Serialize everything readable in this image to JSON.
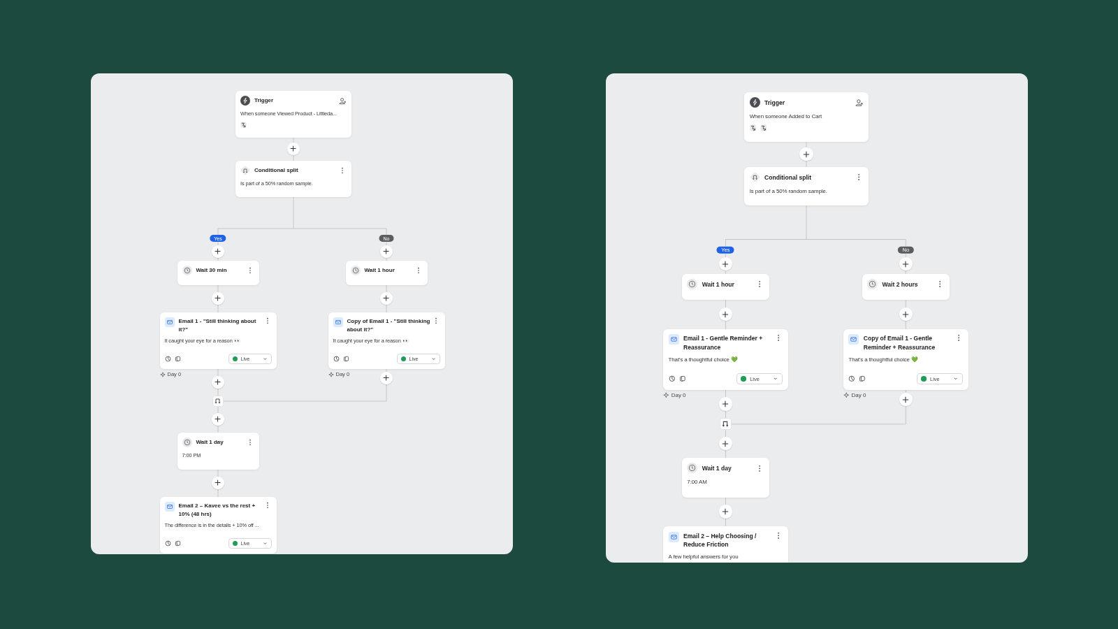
{
  "flows": [
    {
      "trigger": {
        "title": "Trigger",
        "description": "When someone Viewed Product - Littleda...",
        "filters": [
          {
            "kind": "filter"
          }
        ]
      },
      "split": {
        "title": "Conditional split",
        "description": "Is part of a 50% random sample."
      },
      "branches": [
        {
          "label": "Yes",
          "kind": "yes",
          "steps": [
            {
              "kind": "wait",
              "title": "Wait 30 min"
            },
            {
              "kind": "email",
              "title": "Email 1 - \"Still thinking about it?\"",
              "preview": "It caught your eye for a reason 👀",
              "status": "Live",
              "live": true,
              "day": "Day 0"
            }
          ]
        },
        {
          "label": "No",
          "kind": "no",
          "steps": [
            {
              "kind": "wait",
              "title": "Wait 1 hour"
            },
            {
              "kind": "email",
              "title": "Copy of Email 1 - \"Still thinking about it?\"",
              "preview": "It caught your eye for a reason 👀",
              "status": "Live",
              "live": true,
              "day": "Day 0"
            }
          ]
        }
      ],
      "after_merge": [
        {
          "kind": "wait",
          "title": "Wait 1 day",
          "detail": "7:00 PM"
        },
        {
          "kind": "email",
          "title": "Email 2 – Kavee vs the rest + 10% (48 hrs)",
          "preview": "The difference is in the details + 10% off ...",
          "status": "Live",
          "live": true
        }
      ]
    },
    {
      "trigger": {
        "title": "Trigger",
        "description": "When someone Added to Cart",
        "filters": [
          {
            "kind": "filter"
          },
          {
            "kind": "filter"
          }
        ]
      },
      "split": {
        "title": "Conditional split",
        "description": "Is part of a 50% random sample."
      },
      "branches": [
        {
          "label": "Yes",
          "kind": "yes",
          "steps": [
            {
              "kind": "wait",
              "title": "Wait 1 hour"
            },
            {
              "kind": "email",
              "title": "Email 1 - Gentle Reminder + Reassurance",
              "preview": "That's a thoughtful choice 💚",
              "status": "Live",
              "live": true,
              "day": "Day 0"
            }
          ]
        },
        {
          "label": "No",
          "kind": "no",
          "steps": [
            {
              "kind": "wait",
              "title": "Wait 2 hours"
            },
            {
              "kind": "email",
              "title": "Copy of Email 1 - Gentle Reminder + Reassurance",
              "preview": "That's a thoughtful choice 💚",
              "status": "Live",
              "live": true,
              "day": "Day 0"
            }
          ]
        }
      ],
      "after_merge": [
        {
          "kind": "wait",
          "title": "Wait 1 day",
          "detail": "7:00 AM"
        },
        {
          "kind": "email",
          "title": "Email 2 – Help Choosing / Reduce Friction",
          "preview": "A few helpful answers for you"
        }
      ]
    }
  ]
}
